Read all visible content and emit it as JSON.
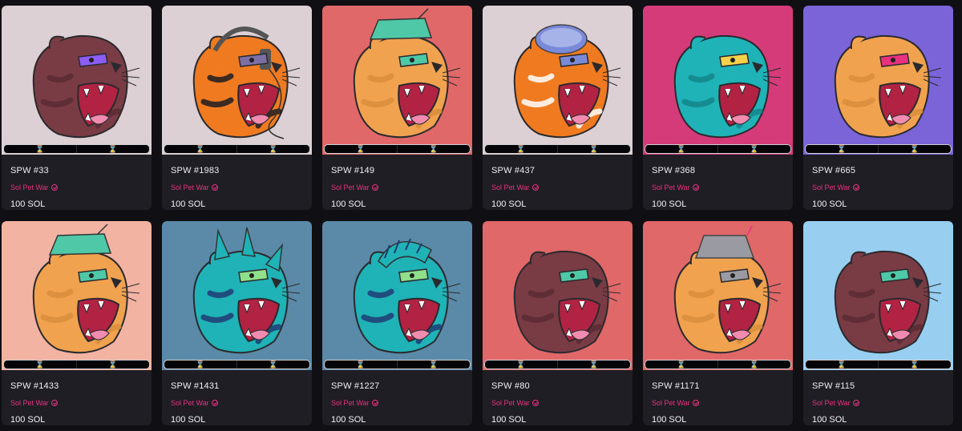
{
  "cards": [
    {
      "name": "SPW #33",
      "collection": "Sol Pet War",
      "price": "100 SOL",
      "bg": "#ddd0d4",
      "fur": "#7a3c44",
      "stripe": "#5b2a33",
      "accent": "#8b5cf6",
      "hat": "none",
      "timer_icons": [
        "⌛",
        "⌛"
      ]
    },
    {
      "name": "SPW #1983",
      "collection": "Sol Pet War",
      "price": "100 SOL",
      "bg": "#ddd0d4",
      "fur": "#ef7a1f",
      "stripe": "#1d1d22",
      "accent": "#7b6fa6",
      "hat": "headphones",
      "timer_icons": [
        "⌛",
        "⌛"
      ]
    },
    {
      "name": "SPW #149",
      "collection": "Sol Pet War",
      "price": "100 SOL",
      "bg": "#e06868",
      "fur": "#f0a24f",
      "stripe": "#d98d3a",
      "accent": "#4fc8a8",
      "hat": "cap",
      "timer_icons": [
        "⌛",
        "⌛"
      ]
    },
    {
      "name": "SPW #437",
      "collection": "Sol Pet War",
      "price": "100 SOL",
      "bg": "#ddd0d4",
      "fur": "#ef7a1f",
      "stripe": "#ffffff",
      "accent": "#7b8ad8",
      "hat": "dome",
      "timer_icons": [
        "⌛",
        "⌛"
      ]
    },
    {
      "name": "SPW #368",
      "collection": "Sol Pet War",
      "price": "100 SOL",
      "bg": "#d53b78",
      "fur": "#1fb2b6",
      "stripe": "#138589",
      "accent": "#f6d24a",
      "hat": "none",
      "timer_icons": [
        "⌛",
        "⌛"
      ]
    },
    {
      "name": "SPW #665",
      "collection": "Sol Pet War",
      "price": "100 SOL",
      "bg": "#7b63d8",
      "fur": "#f0a24f",
      "stripe": "#d98d3a",
      "accent": "#e8327f",
      "hat": "none",
      "timer_icons": [
        "⌛",
        "⌛"
      ]
    },
    {
      "name": "SPW #1433",
      "collection": "Sol Pet War",
      "price": "100 SOL",
      "bg": "#f2b3a2",
      "fur": "#f0a24f",
      "stripe": "#d98d3a",
      "accent": "#4fc8a8",
      "hat": "cap",
      "timer_icons": [
        "⌛",
        "⌛"
      ]
    },
    {
      "name": "SPW #1431",
      "collection": "Sol Pet War",
      "price": "100 SOL",
      "bg": "#5b8aa8",
      "fur": "#1fb2b6",
      "stripe": "#1f3b74",
      "accent": "#8ee08a",
      "hat": "spikes",
      "timer_icons": [
        "⌛",
        "⌛"
      ]
    },
    {
      "name": "SPW #1227",
      "collection": "Sol Pet War",
      "price": "100 SOL",
      "bg": "#5b8aa8",
      "fur": "#1fb2b6",
      "stripe": "#1f3b74",
      "accent": "#8ee08a",
      "hat": "mohawk",
      "timer_icons": [
        "⌛",
        "⌛"
      ]
    },
    {
      "name": "SPW #80",
      "collection": "Sol Pet War",
      "price": "100 SOL",
      "bg": "#e06868",
      "fur": "#7a3c44",
      "stripe": "#5b2a33",
      "accent": "#4fc8a8",
      "hat": "none",
      "timer_icons": [
        "⌛",
        "⌛"
      ]
    },
    {
      "name": "SPW #1171",
      "collection": "Sol Pet War",
      "price": "100 SOL",
      "bg": "#e06868",
      "fur": "#f0a24f",
      "stripe": "#d98d3a",
      "accent": "#9a9aa2",
      "hat": "bucket",
      "timer_icons": [
        "⌛",
        "⌛"
      ]
    },
    {
      "name": "SPW #115",
      "collection": "Sol Pet War",
      "price": "100 SOL",
      "bg": "#98cff0",
      "fur": "#7a3c44",
      "stripe": "#5b2a33",
      "accent": "#4fc8a8",
      "hat": "none",
      "timer_icons": [
        "⌛",
        "⌛"
      ]
    }
  ]
}
